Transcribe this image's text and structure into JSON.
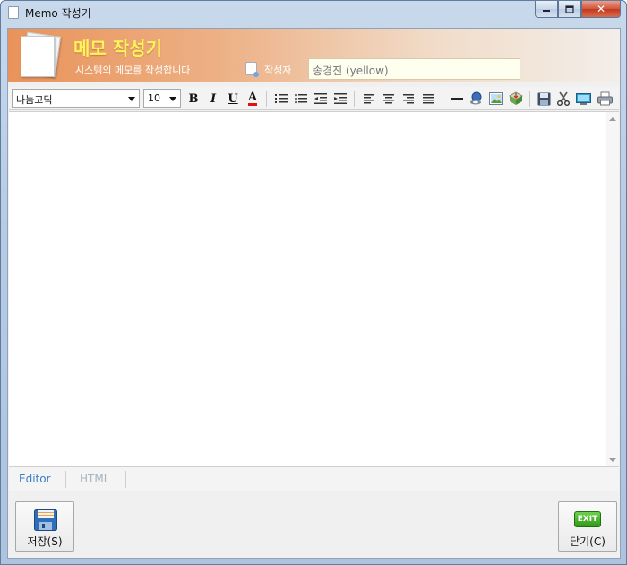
{
  "window": {
    "title": "Memo 작성기",
    "controls": {
      "minimize": "▬",
      "maximize": "▢",
      "close": "✕"
    }
  },
  "header": {
    "title": "메모 작성기",
    "subtitle": "시스템의 메모를 작성합니다",
    "author_label": "작성자",
    "author_value": "송경진 (yellow)"
  },
  "toolbar": {
    "font_family": "나눔고딕",
    "font_size": "10",
    "bold": "B",
    "italic": "I",
    "underline": "U",
    "font_color": "A",
    "icons": [
      "ordered-list-icon",
      "unordered-list-icon",
      "outdent-icon",
      "indent-icon",
      "align-left-icon",
      "align-center-icon",
      "align-right-icon",
      "justify-icon",
      "horizontal-rule-icon",
      "link-icon",
      "image-icon",
      "insert-object-icon",
      "save-icon",
      "cut-icon",
      "preview-icon",
      "print-icon"
    ]
  },
  "mode_tabs": {
    "editor": "Editor",
    "html": "HTML"
  },
  "footer": {
    "save_label": "저장(S)",
    "close_label": "닫기(C)",
    "exit_icon_text": "EXIT"
  },
  "colors": {
    "header_gradient_start": "#e9935a",
    "header_title": "#fff45a",
    "active_tab": "#3a7cc2",
    "close_button": "#c23a1f"
  }
}
